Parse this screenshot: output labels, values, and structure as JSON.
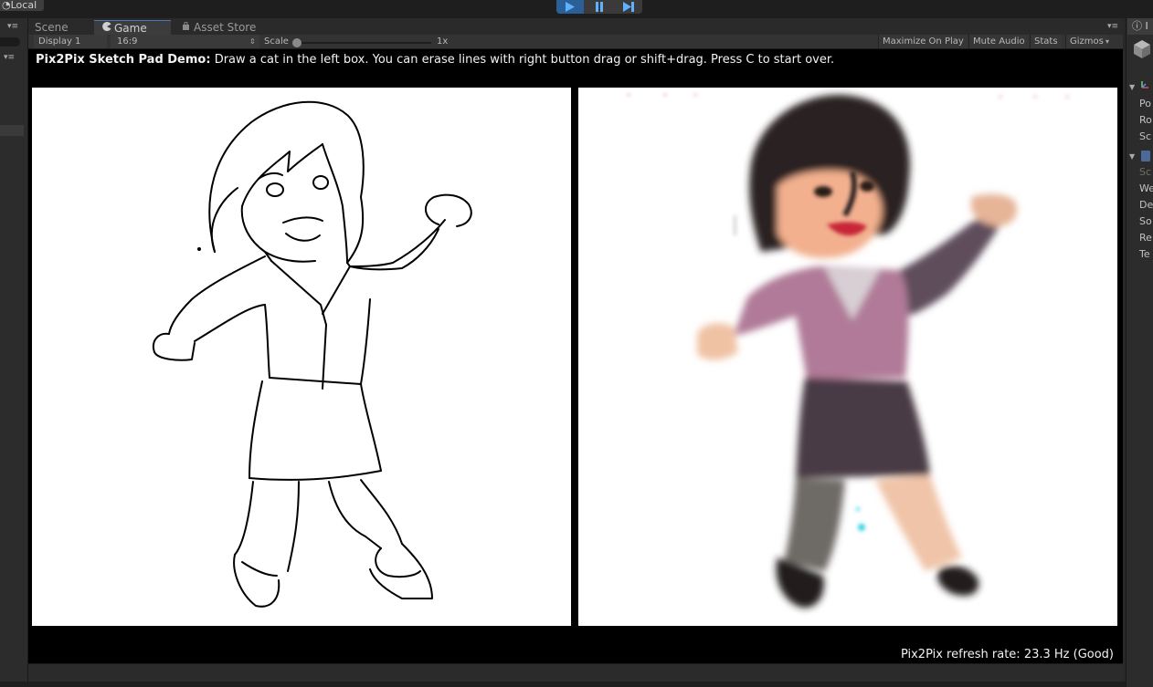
{
  "top_toolbar": {
    "layers_label": "Local"
  },
  "icons": {
    "play": "play-icon",
    "pause": "pause-icon",
    "step": "step-icon",
    "game_tab": "pacman-icon",
    "asset_store": "bag-icon",
    "inspector": "info-icon",
    "cube": "cube-icon"
  },
  "tabs": {
    "scene": "Scene",
    "game": "Game",
    "asset_store": "Asset Store"
  },
  "game_toolbar": {
    "display": "Display 1",
    "aspect": "16:9",
    "scale_label": "Scale",
    "scale_value": "1x",
    "maximize_on_play": "Maximize On Play",
    "mute_audio": "Mute Audio",
    "stats": "Stats",
    "gizmos": "Gizmos"
  },
  "game_view": {
    "banner_title": "Pix2Pix Sketch Pad Demo:",
    "banner_text": " Draw a cat in the left box. You can erase lines with right button drag or shift+drag. Press C to start over.",
    "refresh_rate": "Pix2Pix refresh rate: 23.3 Hz (Good)"
  },
  "inspector": {
    "tab_label": "I",
    "transform_rows": [
      "Po",
      "Ro",
      "Sc"
    ],
    "script_rows": [
      "Sc",
      "We",
      "De",
      "So",
      "Re",
      "Te"
    ]
  },
  "colors": {
    "accent": "#2b5f97",
    "tab_highlight": "#4a77b4",
    "game_bg": "#000000",
    "panel_bg": "#282828"
  }
}
